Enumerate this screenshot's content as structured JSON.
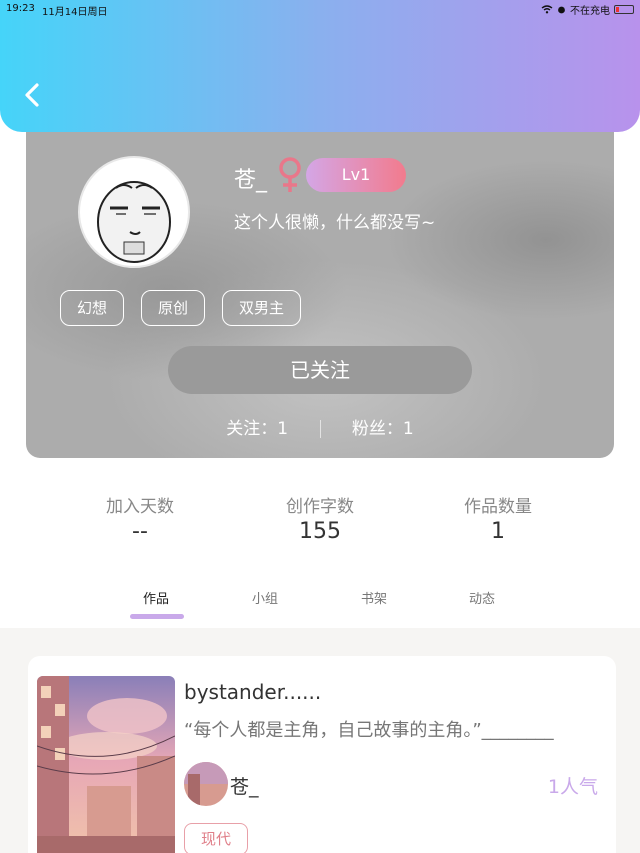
{
  "status_bar": {
    "time": "19:23",
    "date": "11月14日周日",
    "charging": "不在充电"
  },
  "header": {
    "gradient_colors": [
      "#45d4f9",
      "#8ab0ee",
      "#b892ec"
    ],
    "back_icon": "chevron-left-icon"
  },
  "profile": {
    "nickname": "苍_",
    "gender_icon": "female-icon",
    "level": "Lv1",
    "bio": "这个人很懒，什么都没写~",
    "tags": [
      "幻想",
      "原创",
      "双男主"
    ],
    "follow_button": "已关注",
    "following": "关注：1",
    "followers": "粉丝：1"
  },
  "stats": {
    "days_label": "加入天数",
    "days_value": "--",
    "words_label": "创作字数",
    "words_value": "155",
    "works_label": "作品数量",
    "works_value": "1"
  },
  "tabs": {
    "works": "作品",
    "groups": "小组",
    "bookshelf": "书架",
    "moments": "动态"
  },
  "work": {
    "title": "bystander......",
    "description": "“每个人都是主角，自己故事的主角。”________",
    "author": "苍_",
    "popularity": "1人气",
    "genre": "现代"
  },
  "colors": {
    "accent_purple": "#c9a9ea",
    "genre_pink": "#e0808a",
    "level_gradient": [
      "#d4a6e6",
      "#f27b8d"
    ]
  }
}
